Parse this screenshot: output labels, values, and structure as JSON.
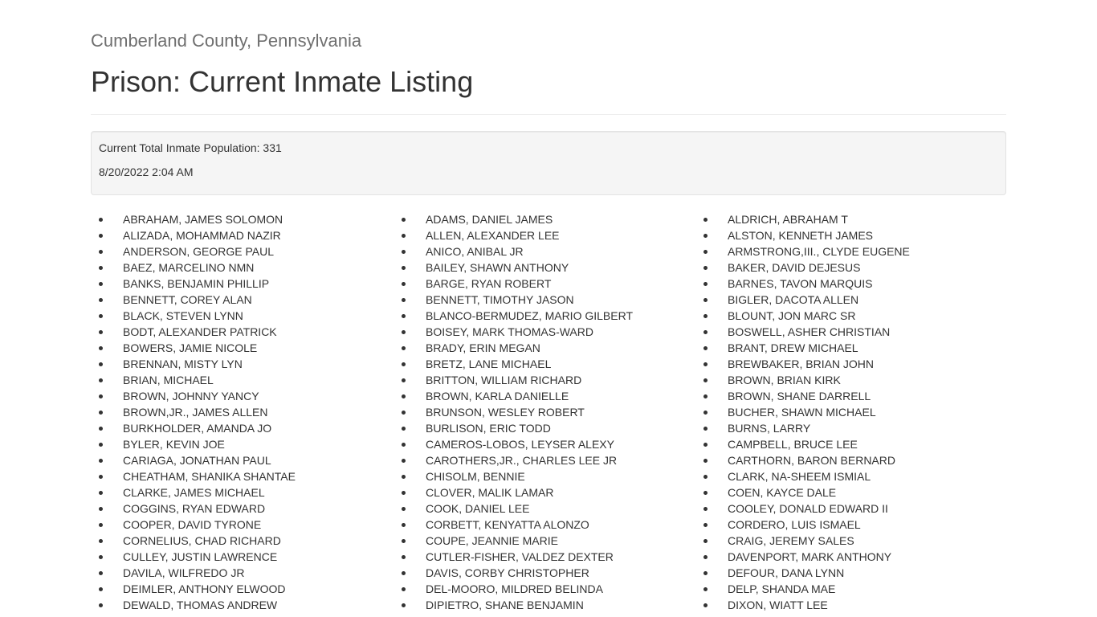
{
  "header": {
    "subtitle": "Cumberland County, Pennsylvania",
    "title": "Prison: Current Inmate Listing"
  },
  "summary": {
    "population": "Current Total Inmate Population: 331",
    "timestamp": "8/20/2022 2:04 AM"
  },
  "inmates": {
    "column1": [
      "ABRAHAM, JAMES SOLOMON",
      "ALIZADA, MOHAMMAD NAZIR",
      "ANDERSON, GEORGE PAUL",
      "BAEZ, MARCELINO NMN",
      "BANKS, BENJAMIN PHILLIP",
      "BENNETT, COREY ALAN",
      "BLACK, STEVEN LYNN",
      "BODT, ALEXANDER PATRICK",
      "BOWERS, JAMIE NICOLE",
      "BRENNAN, MISTY LYN",
      "BRIAN, MICHAEL",
      "BROWN, JOHNNY YANCY",
      "BROWN,JR., JAMES ALLEN",
      "BURKHOLDER, AMANDA JO",
      "BYLER, KEVIN JOE",
      "CARIAGA, JONATHAN PAUL",
      "CHEATHAM, SHANIKA SHANTAE",
      "CLARKE, JAMES MICHAEL",
      "COGGINS, RYAN EDWARD",
      "COOPER, DAVID TYRONE",
      "CORNELIUS, CHAD RICHARD",
      "CULLEY, JUSTIN LAWRENCE",
      "DAVILA, WILFREDO JR",
      "DEIMLER, ANTHONY ELWOOD",
      "DEWALD, THOMAS ANDREW"
    ],
    "column2": [
      "ADAMS, DANIEL JAMES",
      "ALLEN, ALEXANDER LEE",
      "ANICO, ANIBAL JR",
      "BAILEY, SHAWN ANTHONY",
      "BARGE, RYAN ROBERT",
      "BENNETT, TIMOTHY JASON",
      "BLANCO-BERMUDEZ, MARIO GILBERT",
      "BOISEY, MARK THOMAS-WARD",
      "BRADY, ERIN MEGAN",
      "BRETZ, LANE MICHAEL",
      "BRITTON, WILLIAM RICHARD",
      "BROWN, KARLA DANIELLE",
      "BRUNSON, WESLEY ROBERT",
      "BURLISON, ERIC TODD",
      "CAMEROS-LOBOS, LEYSER ALEXY",
      "CAROTHERS,JR., CHARLES LEE JR",
      "CHISOLM, BENNIE",
      "CLOVER, MALIK LAMAR",
      "COOK, DANIEL LEE",
      "CORBETT, KENYATTA ALONZO",
      "COUPE, JEANNIE MARIE",
      "CUTLER-FISHER, VALDEZ DEXTER",
      "DAVIS, CORBY CHRISTOPHER",
      "DEL-MOORO, MILDRED BELINDA",
      "DIPIETRO, SHANE BENJAMIN"
    ],
    "column3": [
      "ALDRICH, ABRAHAM T",
      "ALSTON, KENNETH JAMES",
      "ARMSTRONG,III., CLYDE EUGENE",
      "BAKER, DAVID DEJESUS",
      "BARNES, TAVON MARQUIS",
      "BIGLER, DACOTA ALLEN",
      "BLOUNT, JON MARC SR",
      "BOSWELL, ASHER CHRISTIAN",
      "BRANT, DREW MICHAEL",
      "BREWBAKER, BRIAN JOHN",
      "BROWN, BRIAN KIRK",
      "BROWN, SHANE DARRELL",
      "BUCHER, SHAWN MICHAEL",
      "BURNS, LARRY",
      "CAMPBELL, BRUCE LEE",
      "CARTHORN, BARON BERNARD",
      "CLARK, NA-SHEEM ISMIAL",
      "COEN, KAYCE DALE",
      "COOLEY, DONALD EDWARD II",
      "CORDERO, LUIS ISMAEL",
      "CRAIG, JEREMY SALES",
      "DAVENPORT, MARK ANTHONY",
      "DEFOUR, DANA LYNN",
      "DELP, SHANDA MAE",
      "DIXON, WIATT LEE"
    ]
  }
}
